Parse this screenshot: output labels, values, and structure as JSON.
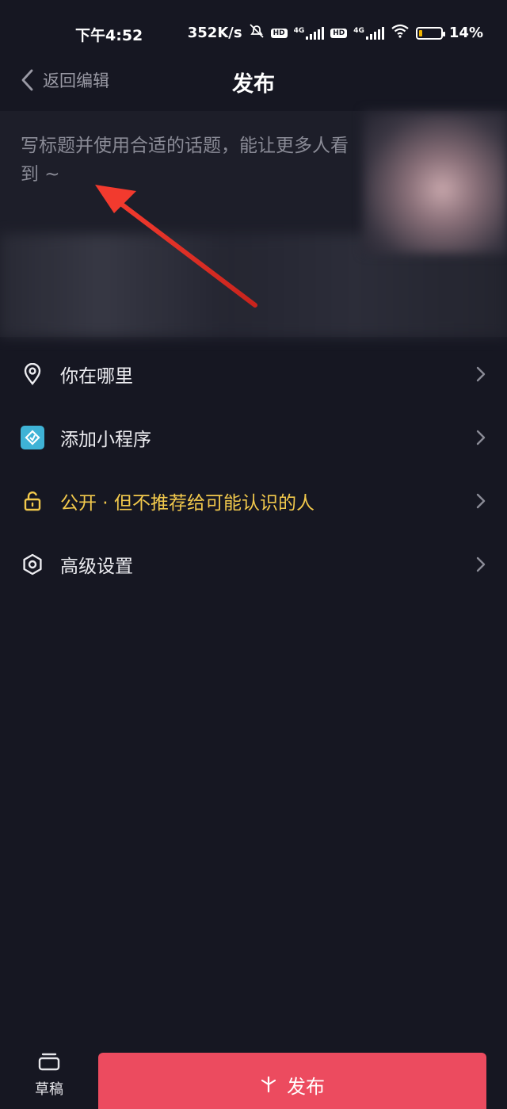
{
  "status_bar": {
    "time": "下午4:52",
    "network_speed": "352K/s",
    "hd_label": "HD",
    "net_4g": "4G",
    "battery": "14%",
    "battery_level": 0.14
  },
  "header": {
    "back_label": "返回编辑",
    "title": "发布"
  },
  "caption": {
    "placeholder": "写标题并使用合适的话题，能让更多人看到 ~"
  },
  "menu": {
    "location": "你在哪里",
    "mini_program": "添加小程序",
    "visibility_primary": "公开",
    "visibility_separator": " · ",
    "visibility_secondary": "但不推荐给可能认识的人",
    "advanced": "高级设置"
  },
  "bottom": {
    "draft_label": "草稿",
    "publish_label": "发布"
  },
  "colors": {
    "background": "#161722",
    "publish_button": "#ec4b5f",
    "visibility_text": "#f2c94c",
    "annotation_arrow": "#e8362c"
  },
  "icons": {
    "back": "chevron-left-icon",
    "location": "location-pin-icon",
    "mini_program": "mini-program-icon",
    "visibility": "unlock-icon",
    "advanced": "hexagon-settings-icon",
    "chevron": "chevron-right-icon",
    "draft": "draft-box-icon",
    "publish": "sparkle-icon"
  }
}
